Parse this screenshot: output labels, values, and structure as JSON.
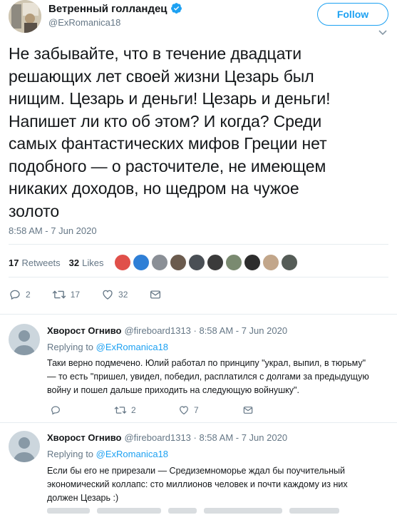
{
  "tweet": {
    "author_name": "Ветренный голландец",
    "author_handle": "@ExRomanica18",
    "follow_label": "Follow",
    "text": "Не забывайте, что в течение двадцати\nрешающих лет своей жизни Цезарь был\nнищим. Цезарь и деньги! Цезарь и деньги!\nНапишет ли кто об этом? И когда? Среди\nсамых фантастических мифов Греции нет\nподобного — о расточителе, не имеющем\nникаких доходов, но щедром на чужое\nзолото",
    "timestamp": "8:58 AM - 7 Jun 2020",
    "retweets_count": "17",
    "retweets_label": "Retweets",
    "likes_count": "32",
    "likes_label": "Likes",
    "actions": {
      "reply_count": "2",
      "retweet_count": "17",
      "like_count": "32"
    }
  },
  "replies": [
    {
      "author_name": "Хворост Огниво",
      "meta": "@fireboard1313 · 8:58 AM - 7 Jun 2020",
      "replying_prefix": "Replying to",
      "replying_to": "@ExRomanica18",
      "text": "Таки верно подмечено. Юлий работал по принципу \"украл, выпил, в тюрьму\"\n— то есть \"пришел, увидел, победил, расплатился с долгами за предыдущую\nвойну и пошел дальше приходить на следующую войнушку\".",
      "reply_count": "",
      "retweet_count": "2",
      "like_count": "7"
    },
    {
      "author_name": "Хворост Огниво",
      "meta": "@fireboard1313 · 8:58 AM - 7 Jun 2020",
      "replying_prefix": "Replying to",
      "replying_to": "@ExRomanica18",
      "text": "Если бы его не прирезали — Средиземноморье ждал бы поучительный\nэкономический коллапс: сто миллионов человек и почти каждому из них\nдолжен Цезарь :)"
    }
  ],
  "colors": {
    "accent": "#1da1f2",
    "muted": "#657786",
    "text": "#14171a",
    "divider": "#e6ecf0"
  },
  "icons": [
    "verified-icon",
    "chevron-down-icon",
    "reply-icon",
    "retweet-icon",
    "like-icon",
    "message-icon",
    "default-avatar-icon"
  ]
}
